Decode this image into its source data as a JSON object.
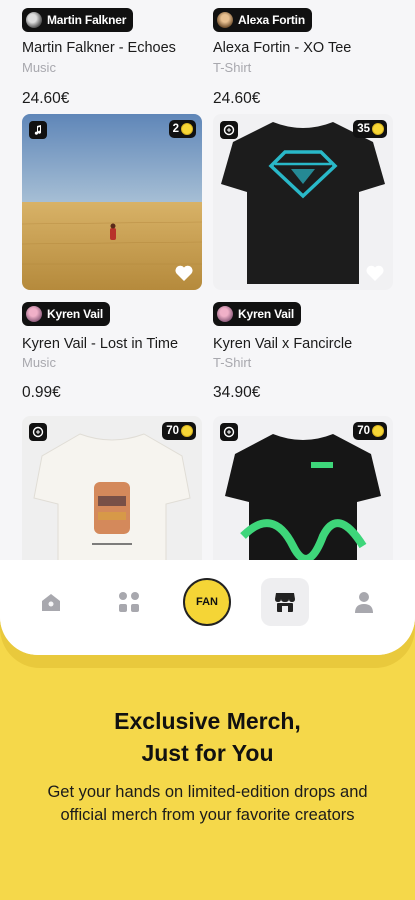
{
  "products": [
    {
      "creator": "Martin Falkner",
      "title": "Martin Falkner - Echoes",
      "category": "Music",
      "price": "24.60€"
    },
    {
      "creator": "Alexa Fortin",
      "title": "Alexa Fortin - XO Tee",
      "category": "T-Shirt",
      "price": "24.60€"
    },
    {
      "creator": "Kyren Vail",
      "title": "Kyren Vail - Lost in Time",
      "category": "Music",
      "price": "0.99€",
      "count": "2"
    },
    {
      "creator": "Kyren Vail",
      "title": "Kyren Vail x Fancircle",
      "category": "T-Shirt",
      "price": "34.90€",
      "count": "35"
    },
    {
      "count": "70"
    },
    {
      "count": "70"
    }
  ],
  "nav": {
    "items": [
      "home-icon",
      "categories-icon",
      "fan-logo",
      "shop-icon",
      "profile-icon"
    ],
    "fan_label": "FAN"
  },
  "promo": {
    "title_line1": "Exclusive Merch,",
    "title_line2": "Just for You",
    "body": "Get your hands on limited-edition drops and official merch from your favorite creators"
  },
  "colors": {
    "accent": "#f5d84a",
    "chip": "#111111"
  }
}
